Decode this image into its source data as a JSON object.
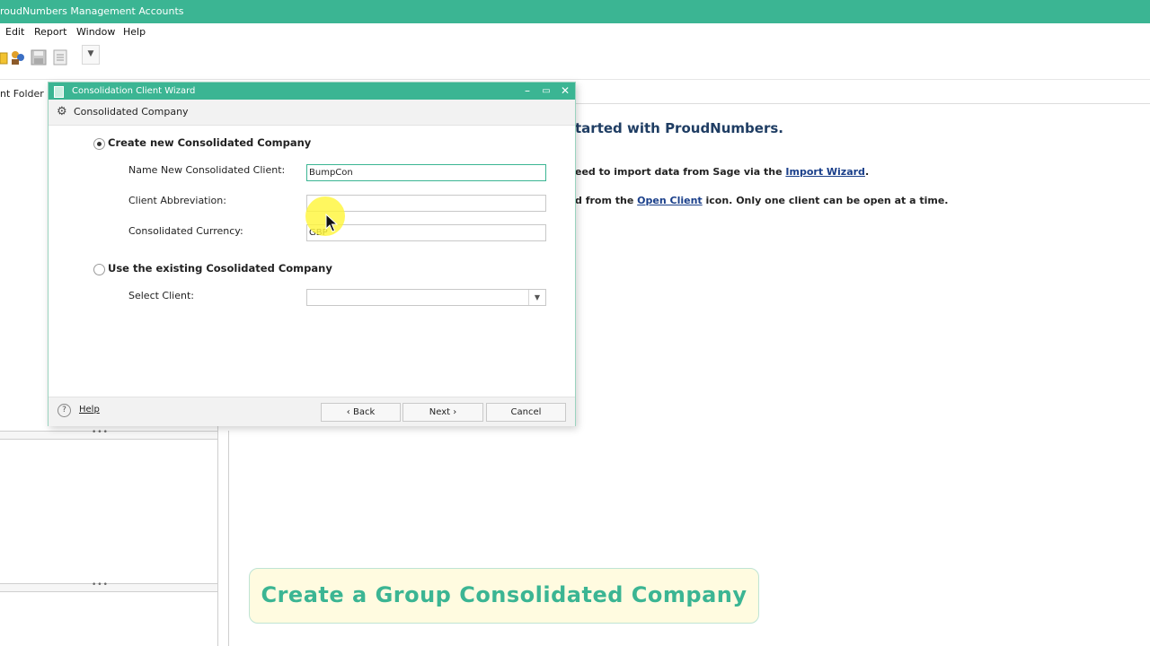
{
  "app": {
    "title": "roudNumbers Management Accounts",
    "menu": [
      "Edit",
      "Report",
      "Window",
      "Help"
    ]
  },
  "left_panel": {
    "folder_label": "nt Folder"
  },
  "welcome": {
    "title": "tarted with ProudNumbers.",
    "line1_prefix": "eed to import data from Sage via the ",
    "line1_link": "Import Wizard",
    "line1_suffix": ".",
    "line2_prefix": "d from the ",
    "line2_link": "Open Client",
    "line2_suffix": " icon. Only one client can be open at a time."
  },
  "wizard": {
    "title": "Consolidation Client Wizard",
    "header": "Consolidated Company",
    "option_new": {
      "label": "Create new Consolidated Company",
      "selected": true,
      "name_label": "Name New Consolidated Client:",
      "name_value": "BumpCon",
      "abbr_label": "Client Abbreviation:",
      "abbr_value": "",
      "currency_label": "Consolidated Currency:",
      "currency_value": "GBP"
    },
    "option_existing": {
      "label": "Use the existing Cosolidated Company",
      "selected": false,
      "select_label": "Select Client:",
      "select_value": ""
    },
    "footer": {
      "help": "Help",
      "back": "Back",
      "next": "Next",
      "cancel": "Cancel"
    }
  },
  "caption": "Create a Group Consolidated Company",
  "colors": {
    "accent": "#3bb593",
    "link": "#1a3f8a",
    "caption_bg": "#fffbe0",
    "cursor_halo": "#fff53c"
  },
  "icons": [
    "open-folder-icon",
    "clients-icon",
    "save-icon",
    "report-icon",
    "dropdown-arrow-icon",
    "gear-icon",
    "help-icon",
    "minimize-icon",
    "maximize-icon",
    "close-icon",
    "mouse-cursor-icon"
  ]
}
